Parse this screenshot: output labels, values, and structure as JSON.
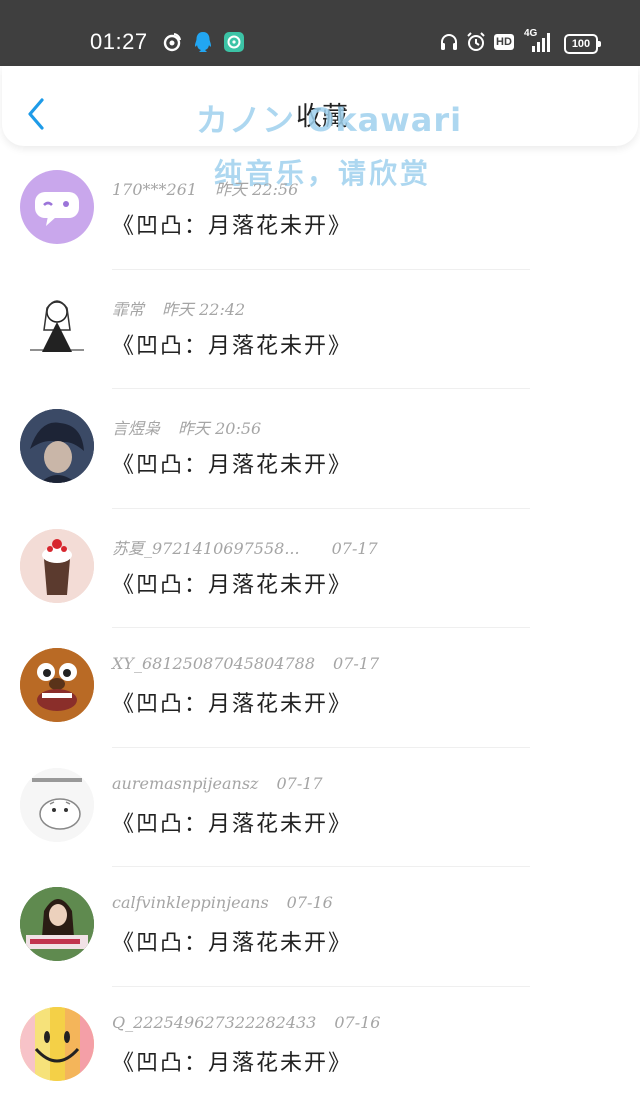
{
  "status_bar": {
    "time": "01:27",
    "battery": "100",
    "network": "4G",
    "hd_label": "HD",
    "icons": [
      "weibo-icon",
      "qq-icon",
      "chat-app-icon",
      "headset-icon",
      "alarm-icon",
      "hd-icon",
      "signal-icon",
      "battery-icon"
    ]
  },
  "header": {
    "title": "收藏",
    "back_icon": "chevron-left-icon"
  },
  "watermark": {
    "line1": "カノン  Okawari",
    "line2": "纯音乐，请欣赏"
  },
  "items": [
    {
      "user": "170***261",
      "time": "昨天 22:56",
      "content": "《凹凸：月落花未开》",
      "avatar_color": "#c9a7ec"
    },
    {
      "user": "霏常",
      "time": "昨天 22:42",
      "content": "《凹凸：月落花未开》",
      "avatar_color": "#e8e8e8"
    },
    {
      "user": "言煜枭",
      "time": "昨天 20:56",
      "content": "《凹凸：月落花未开》",
      "avatar_color": "#2e3b55"
    },
    {
      "user": "苏夏_9721410697558...",
      "time": "07-17",
      "content": "《凹凸：月落花未开》",
      "avatar_color": "#e8c0b8"
    },
    {
      "user": "XY_68125087045804788",
      "time": "07-17",
      "content": "《凹凸：月落花未开》",
      "avatar_color": "#c9782f"
    },
    {
      "user": "auremasnpijeansz",
      "time": "07-17",
      "content": "《凹凸：月落花未开》",
      "avatar_color": "#f4f4f4"
    },
    {
      "user": "calfvinkleppinjeans",
      "time": "07-16",
      "content": "《凹凸：月落花未开》",
      "avatar_color": "#3f6b3a"
    },
    {
      "user": "Q_222549627322282433",
      "time": "07-16",
      "content": "《凹凸：月落花未开》",
      "avatar_color": "#f4d36a"
    }
  ]
}
